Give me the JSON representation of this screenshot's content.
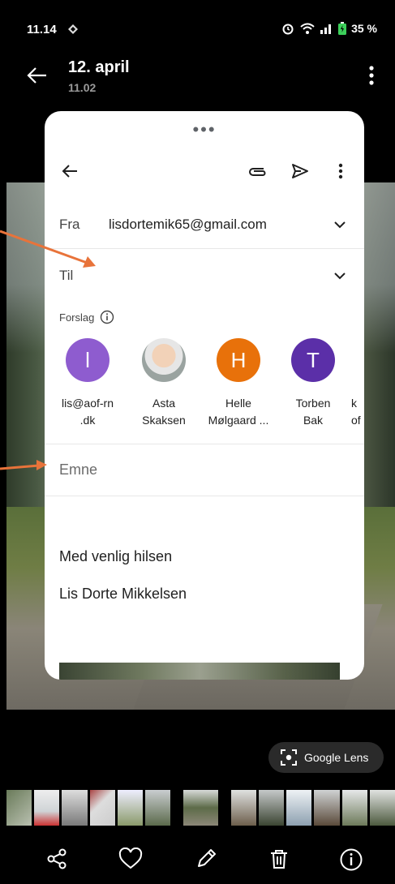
{
  "status": {
    "time": "11.14",
    "battery": "35 %"
  },
  "header": {
    "title": "12. april",
    "subtitle": "11.02"
  },
  "compose": {
    "from_label": "Fra",
    "from_value": "lisdortemik65@gmail.com",
    "to_label": "Til",
    "suggestions_label": "Forslag",
    "suggestions": [
      {
        "initial": "l",
        "line1": "lis@aof-rn",
        "line2": ".dk",
        "color": "#8e5ccf"
      },
      {
        "initial": "",
        "line1": "Asta",
        "line2": "Skaksen",
        "color": "#d8cfc2"
      },
      {
        "initial": "H",
        "line1": "Helle",
        "line2": "Mølgaard ...",
        "color": "#e8710a"
      },
      {
        "initial": "T",
        "line1": "Torben",
        "line2": "Bak",
        "color": "#5b2fa8"
      },
      {
        "initial": "",
        "line1": "k",
        "line2": "of",
        "color": "#ffffff"
      }
    ],
    "subject_placeholder": "Emne",
    "signature_line1": "Med venlig hilsen",
    "signature_line2": "Lis Dorte Mikkelsen"
  },
  "lens": {
    "label": "Google Lens"
  },
  "colors": {
    "arrow": "#e8733a",
    "accent": "#8e5ccf"
  }
}
